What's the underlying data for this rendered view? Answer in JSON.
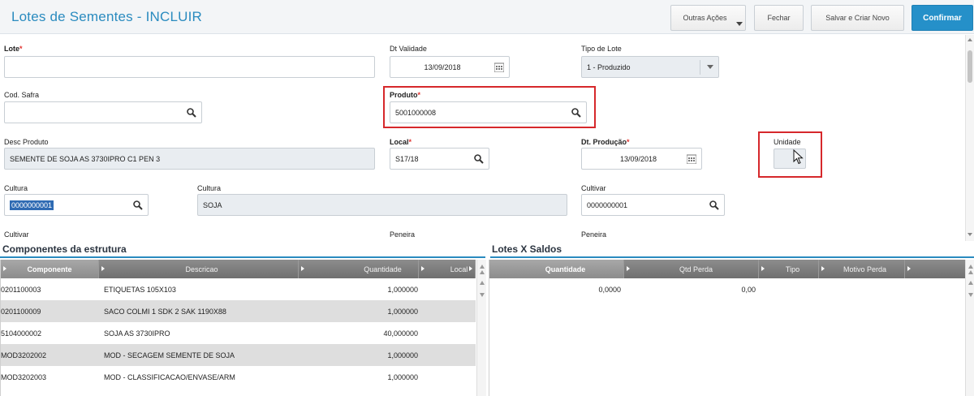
{
  "header": {
    "title": "Lotes  de Sementes - INCLUIR",
    "buttons": {
      "outras_acoes": "Outras Ações",
      "fechar": "Fechar",
      "salvar_criar_novo": "Salvar e Criar Novo",
      "confirmar": "Confirmar"
    }
  },
  "form": {
    "lote": {
      "label": "Lote",
      "required": "*",
      "value": ""
    },
    "dt_validade": {
      "label": "Dt Validade",
      "value": "13/09/2018",
      "icon": "calendar-icon"
    },
    "tipo_lote": {
      "label": "Tipo de Lote",
      "value": "1 - Produzido"
    },
    "cod_safra": {
      "label": "Cod. Safra",
      "value": "",
      "icon": "search-icon"
    },
    "produto": {
      "label": "Produto",
      "required": "*",
      "value": "5001000008",
      "icon": "search-icon"
    },
    "desc_produto": {
      "label": "Desc Produto",
      "value": "SEMENTE DE SOJA AS 3730IPRO C1 PEN 3"
    },
    "local": {
      "label": "Local",
      "required": "*",
      "value": "S17/18",
      "icon": "search-icon"
    },
    "dt_producao": {
      "label": "Dt. Produção",
      "required": "*",
      "value": "13/09/2018",
      "icon": "calendar-icon"
    },
    "unidade": {
      "label": "Unidade",
      "value": ""
    },
    "cultura_cod": {
      "label": "Cultura",
      "value": "0000000001",
      "icon": "search-icon"
    },
    "cultura_desc": {
      "label": "Cultura",
      "value": "SOJA"
    },
    "cultivar": {
      "label": "Cultivar",
      "value": "0000000001",
      "icon": "search-icon"
    },
    "cultivar2": {
      "label": "Cultivar"
    },
    "peneira1": {
      "label": "Peneira"
    },
    "peneira2": {
      "label": "Peneira"
    }
  },
  "componentes": {
    "title": "Componentes da estrutura",
    "columns": [
      "Componente",
      "Descricao",
      "Quantidade",
      "Local"
    ],
    "rows": [
      {
        "componente": "0201100003",
        "descricao": "ETIQUETAS 105X103",
        "quantidade": "1,000000",
        "local": ""
      },
      {
        "componente": "0201100009",
        "descricao": "SACO COLMI 1 SDK 2 SAK 1190X88",
        "quantidade": "1,000000",
        "local": ""
      },
      {
        "componente": "5104000002",
        "descricao": "SOJA AS 3730IPRO",
        "quantidade": "40,000000",
        "local": ""
      },
      {
        "componente": "MOD3202002",
        "descricao": "MOD - SECAGEM SEMENTE DE SOJA",
        "quantidade": "1,000000",
        "local": ""
      },
      {
        "componente": "MOD3202003",
        "descricao": "MOD - CLASSIFICACAO/ENVASE/ARM",
        "quantidade": "1,000000",
        "local": ""
      }
    ]
  },
  "lotes_saldos": {
    "title": "Lotes X Saldos",
    "columns": [
      "Quantidade",
      "Qtd Perda",
      "Tipo",
      "Motivo Perda"
    ],
    "rows": [
      {
        "quantidade": "0,0000",
        "qtd_perda": "0,00",
        "tipo": "",
        "motivo_perda": ""
      }
    ]
  },
  "colors": {
    "accent": "#2a8bbf",
    "primary_button": "#2590c9",
    "required": "#e0332f",
    "highlight_box": "#d6282b",
    "grid_header": "#7d7d7d",
    "row_alt": "#dedede"
  }
}
